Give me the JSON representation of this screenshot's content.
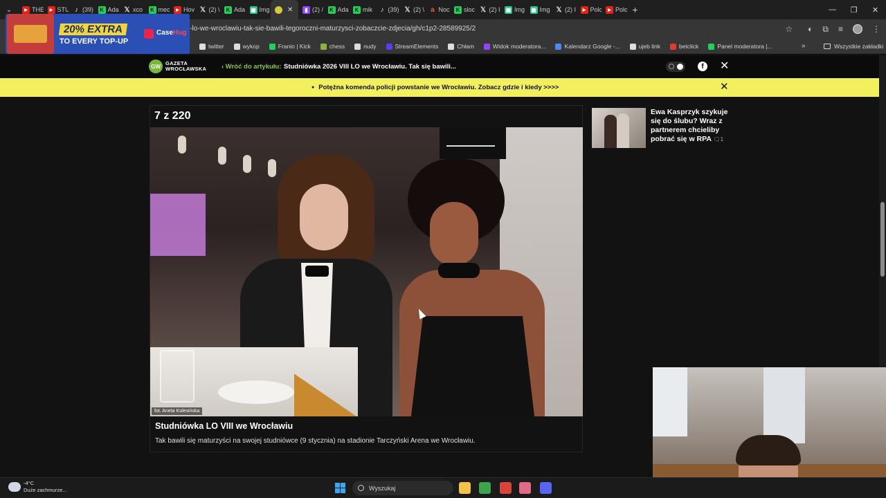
{
  "browser": {
    "tabs": [
      {
        "icon": "youtube-icon",
        "label": "THE"
      },
      {
        "icon": "youtube-icon",
        "label": "STU"
      },
      {
        "icon": "tiktok-icon",
        "label": "(39)"
      },
      {
        "icon": "kick-icon",
        "label": "Ada"
      },
      {
        "icon": "x-icon",
        "label": "xco"
      },
      {
        "icon": "kick-icon",
        "label": "mec"
      },
      {
        "icon": "youtube-icon",
        "label": "Hov"
      },
      {
        "icon": "x-icon",
        "label": "(2) \\"
      },
      {
        "icon": "kick-icon",
        "label": "Ada"
      },
      {
        "icon": "imgsli-icon",
        "label": "Img"
      },
      {
        "icon": "chrome-icon",
        "label": "",
        "active": true
      },
      {
        "icon": "twitch-icon",
        "label": "(2) /"
      },
      {
        "icon": "kick-icon",
        "label": "Ada"
      },
      {
        "icon": "kick-icon",
        "label": "mik"
      },
      {
        "icon": "tiktok-icon",
        "label": "(39)"
      },
      {
        "icon": "x-icon",
        "label": "(2) \\"
      },
      {
        "icon": "amazon-icon",
        "label": "Noc"
      },
      {
        "icon": "kick-icon",
        "label": "sloc"
      },
      {
        "icon": "x-icon",
        "label": "(2) I"
      },
      {
        "icon": "imgsli-icon",
        "label": "Img"
      },
      {
        "icon": "imgsli-icon",
        "label": "Img"
      },
      {
        "icon": "x-icon",
        "label": "(2) I"
      },
      {
        "icon": "youtube-icon",
        "label": "Polc"
      },
      {
        "icon": "youtube-icon",
        "label": "Polc"
      }
    ],
    "url": "i-lo-we-wroclawiu-tak-sie-bawili-tegoroczni-maturzysci-zobaczcie-zdjecia/gh/c1p2-28589925/2",
    "bookmarks": [
      {
        "label": "twitter",
        "color": "#dddddd"
      },
      {
        "label": "wykop",
        "color": "#dddddd"
      },
      {
        "label": "Franio | Kick",
        "color": "#1fd35a"
      },
      {
        "label": "chess",
        "color": "#8bb33a"
      },
      {
        "label": "nudy",
        "color": "#dddddd"
      },
      {
        "label": "StreamElements",
        "color": "#5b3df0"
      },
      {
        "label": "Chłam",
        "color": "#dddddd"
      },
      {
        "label": "Widok moderatora...",
        "color": "#9146ff"
      },
      {
        "label": "Kalendarz Google -...",
        "color": "#4a8af4"
      },
      {
        "label": "ujeb link",
        "color": "#dddddd"
      },
      {
        "label": "betclick",
        "color": "#e23a2e"
      },
      {
        "label": "Panel moderatora |...",
        "color": "#1fd35a"
      }
    ],
    "bookmarks_more": "»",
    "bookmarks_all": "Wszystkie zakładki"
  },
  "ad": {
    "headline": "20% EXTRA",
    "subline": "TO EVERY TOP-UP",
    "brand_a": "Case",
    "brand_b": "Hug"
  },
  "site": {
    "logo_initials": "GW",
    "logo_line1": "GAZETA",
    "logo_line2": "WROCŁAWSKA",
    "back_label": "‹ Wróć do artykułu:",
    "article_title": "Studniówka 2026 VIII LO we Wrocławiu. Tak się bawili...",
    "notice": "Potężna komenda policji powstanie we Wrocławiu. Zobacz gdzie i kiedy >>>>"
  },
  "gallery": {
    "counter": "7 z 220",
    "photo_credit": "fot. Aneta Kolesińska",
    "caption_title": "Studniówka LO VIII we Wrocławiu",
    "caption_text": "Tak bawili się maturzyści na swojej studniówce (9 stycznia) na stadionie Tarczyński Arena we Wrocławiu."
  },
  "related": {
    "title": "Ewa Kasprzyk szykuje się do ślubu? Wraz z partnerem chcieliby pobrać się w RPA",
    "comments": "1"
  },
  "taskbar": {
    "temperature": "-4°C",
    "weather": "Duże zachmurze...",
    "search_placeholder": "Wyszukaj",
    "apps": [
      {
        "name": "file-explorer",
        "color": "#f2c24a"
      },
      {
        "name": "chrome",
        "color": "#3fa34d"
      },
      {
        "name": "app-red",
        "color": "#d8433a"
      },
      {
        "name": "snipping",
        "color": "#e06a8a"
      },
      {
        "name": "discord",
        "color": "#5865f2"
      }
    ]
  }
}
